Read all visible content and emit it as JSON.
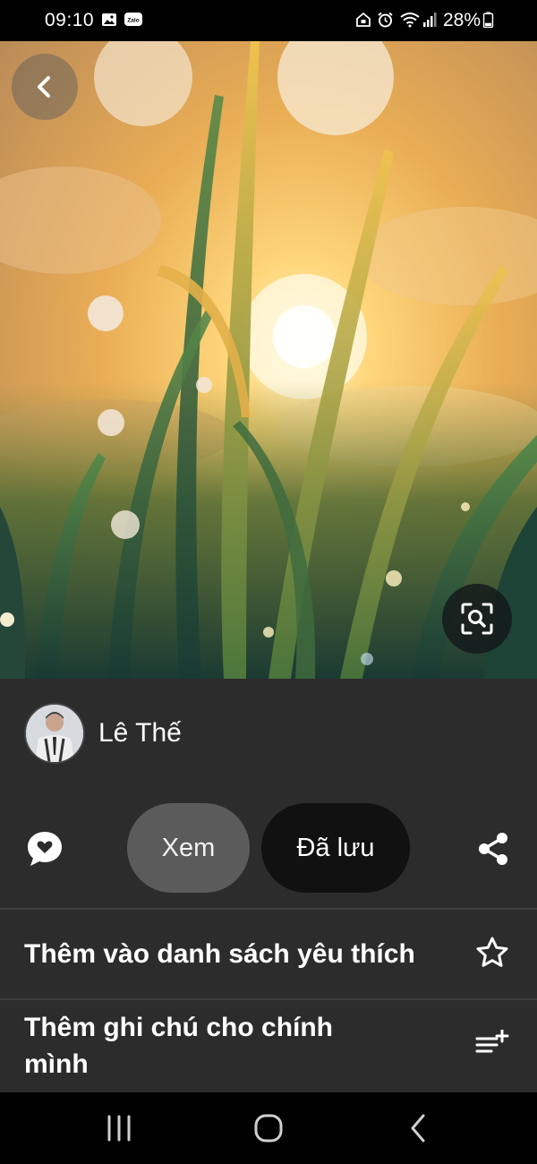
{
  "status_bar": {
    "time": "09:10",
    "battery_percent": "28%",
    "left_icons": [
      "gallery-icon",
      "zalo-icon"
    ],
    "zalo_label": "Zalo",
    "right_icons": [
      "home-lock-icon",
      "alarm-icon",
      "wifi-icon",
      "signal-icon",
      "battery-icon"
    ],
    "battery_level": 0.28
  },
  "pin": {
    "creator_name": "Lê Thế",
    "view_label": "Xem",
    "saved_label": "Đã lưu"
  },
  "menu": {
    "favorite_label": "Thêm vào danh sách yêu thích",
    "note_label_line1": "Thêm ghi chú cho chính",
    "note_label_line2": "mình"
  },
  "colors": {
    "panel_bg": "#2c2c2c",
    "view_pill": "#5b5b5b",
    "saved_pill": "#111111"
  }
}
